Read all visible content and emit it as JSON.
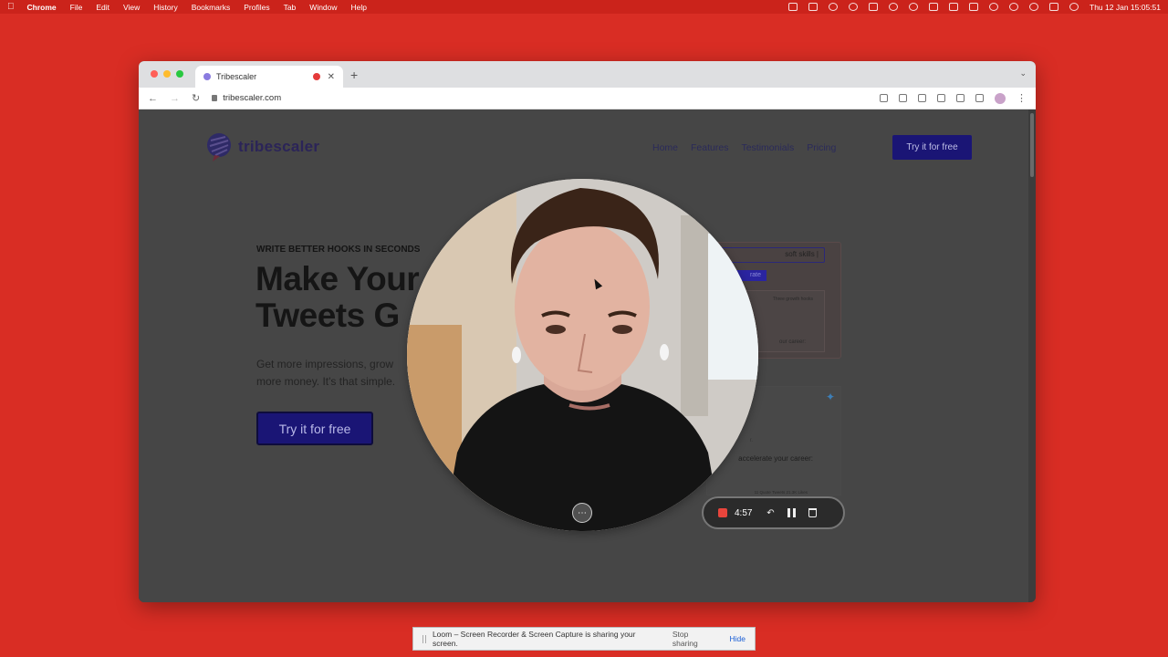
{
  "menubar": {
    "app": "Chrome",
    "menus": [
      "File",
      "Edit",
      "View",
      "History",
      "Bookmarks",
      "Profiles",
      "Tab",
      "Window",
      "Help"
    ],
    "clock": "Thu 12 Jan  15:05:51"
  },
  "browser": {
    "tab_title": "Tribescaler",
    "url": "tribescaler.com"
  },
  "site": {
    "brand": "tribescaler",
    "nav": [
      "Home",
      "Features",
      "Testimonials",
      "Pricing"
    ],
    "cta_top": "Try it for free",
    "eyebrow": "WRITE BETTER HOOKS IN SECONDS",
    "headline_line1": "Make Your",
    "headline_line2": "Tweets G",
    "sub_line1": "Get more impressions, grow",
    "sub_line2": "more money. It's that simple.",
    "cta_main": "Try it for free",
    "demo_input": "soft skills |",
    "demo_button": "rate",
    "demo_card_title": "Three growth hooks",
    "demo_card_line": "our career:",
    "tweet_line": "accelerate your career:",
    "tweet_dash": "r.",
    "tweet_stats": "11 Quote Tweets   21.3K Likes"
  },
  "loom": {
    "timer": "4:57",
    "more_label": "⋯",
    "share_message": "Loom – Screen Recorder & Screen Capture is sharing your screen.",
    "stop_sharing": "Stop sharing",
    "hide": "Hide"
  },
  "colors": {
    "desktop": "#d92d24",
    "brand_primary": "#1a1575",
    "record_red": "#e8453c"
  }
}
